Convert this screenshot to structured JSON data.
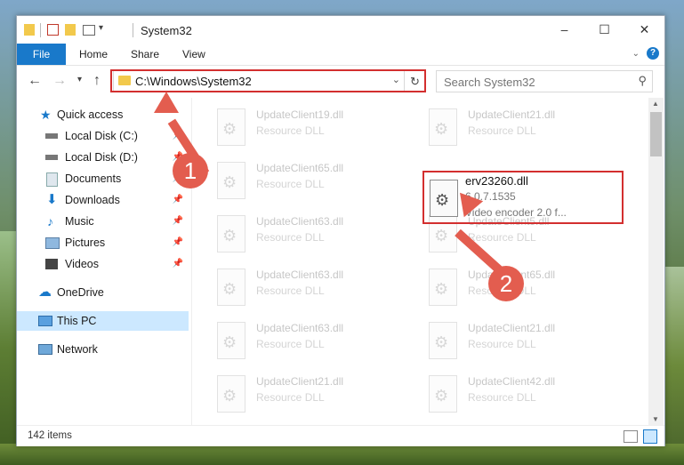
{
  "window": {
    "title": "System32",
    "controls": {
      "minimize": "–",
      "maximize": "☐",
      "close": "✕"
    }
  },
  "ribbon": {
    "tabs": [
      "File",
      "Home",
      "Share",
      "View"
    ]
  },
  "navigation": {
    "address": "C:\\Windows\\System32",
    "search_placeholder": "Search System32"
  },
  "sidebar": {
    "items": [
      {
        "label": "Quick access"
      },
      {
        "label": "Local Disk (C:)"
      },
      {
        "label": "Local Disk (D:)"
      },
      {
        "label": "Documents"
      },
      {
        "label": "Downloads"
      },
      {
        "label": "Music"
      },
      {
        "label": "Pictures"
      },
      {
        "label": "Videos"
      },
      {
        "label": "OneDrive"
      },
      {
        "label": "This PC"
      },
      {
        "label": "Network"
      }
    ]
  },
  "files": [
    {
      "name": "UpdateClient19.dll",
      "type": "Resource DLL"
    },
    {
      "name": "UpdateClient21.dll",
      "type": "Resource DLL"
    },
    {
      "name": "UpdateClient65.dll",
      "type": "Resource DLL"
    },
    {
      "name": "UpdateClient63.dll",
      "type": "Resource DLL"
    },
    {
      "name": "UpdateClient5.dll",
      "type": "Resource DLL"
    },
    {
      "name": "UpdateClient63.dll",
      "type": "Resource DLL"
    },
    {
      "name": "UpdateClient65.dll",
      "type": "Resource DLL"
    },
    {
      "name": "UpdateClient63.dll",
      "type": "Resource DLL"
    },
    {
      "name": "UpdateClient21.dll",
      "type": "Resource DLL"
    },
    {
      "name": "UpdateClient21.dll",
      "type": "Resource DLL"
    },
    {
      "name": "UpdateClient42.dll",
      "type": "Resource DLL"
    }
  ],
  "target_file": {
    "name": "erv23260.dll",
    "version": "6.0.7.1535",
    "description": "Video encoder 2.0 f..."
  },
  "annotations": {
    "badge1": "1",
    "badge2": "2",
    "color": "#e35d4f"
  },
  "status": {
    "item_count": "142 items"
  }
}
